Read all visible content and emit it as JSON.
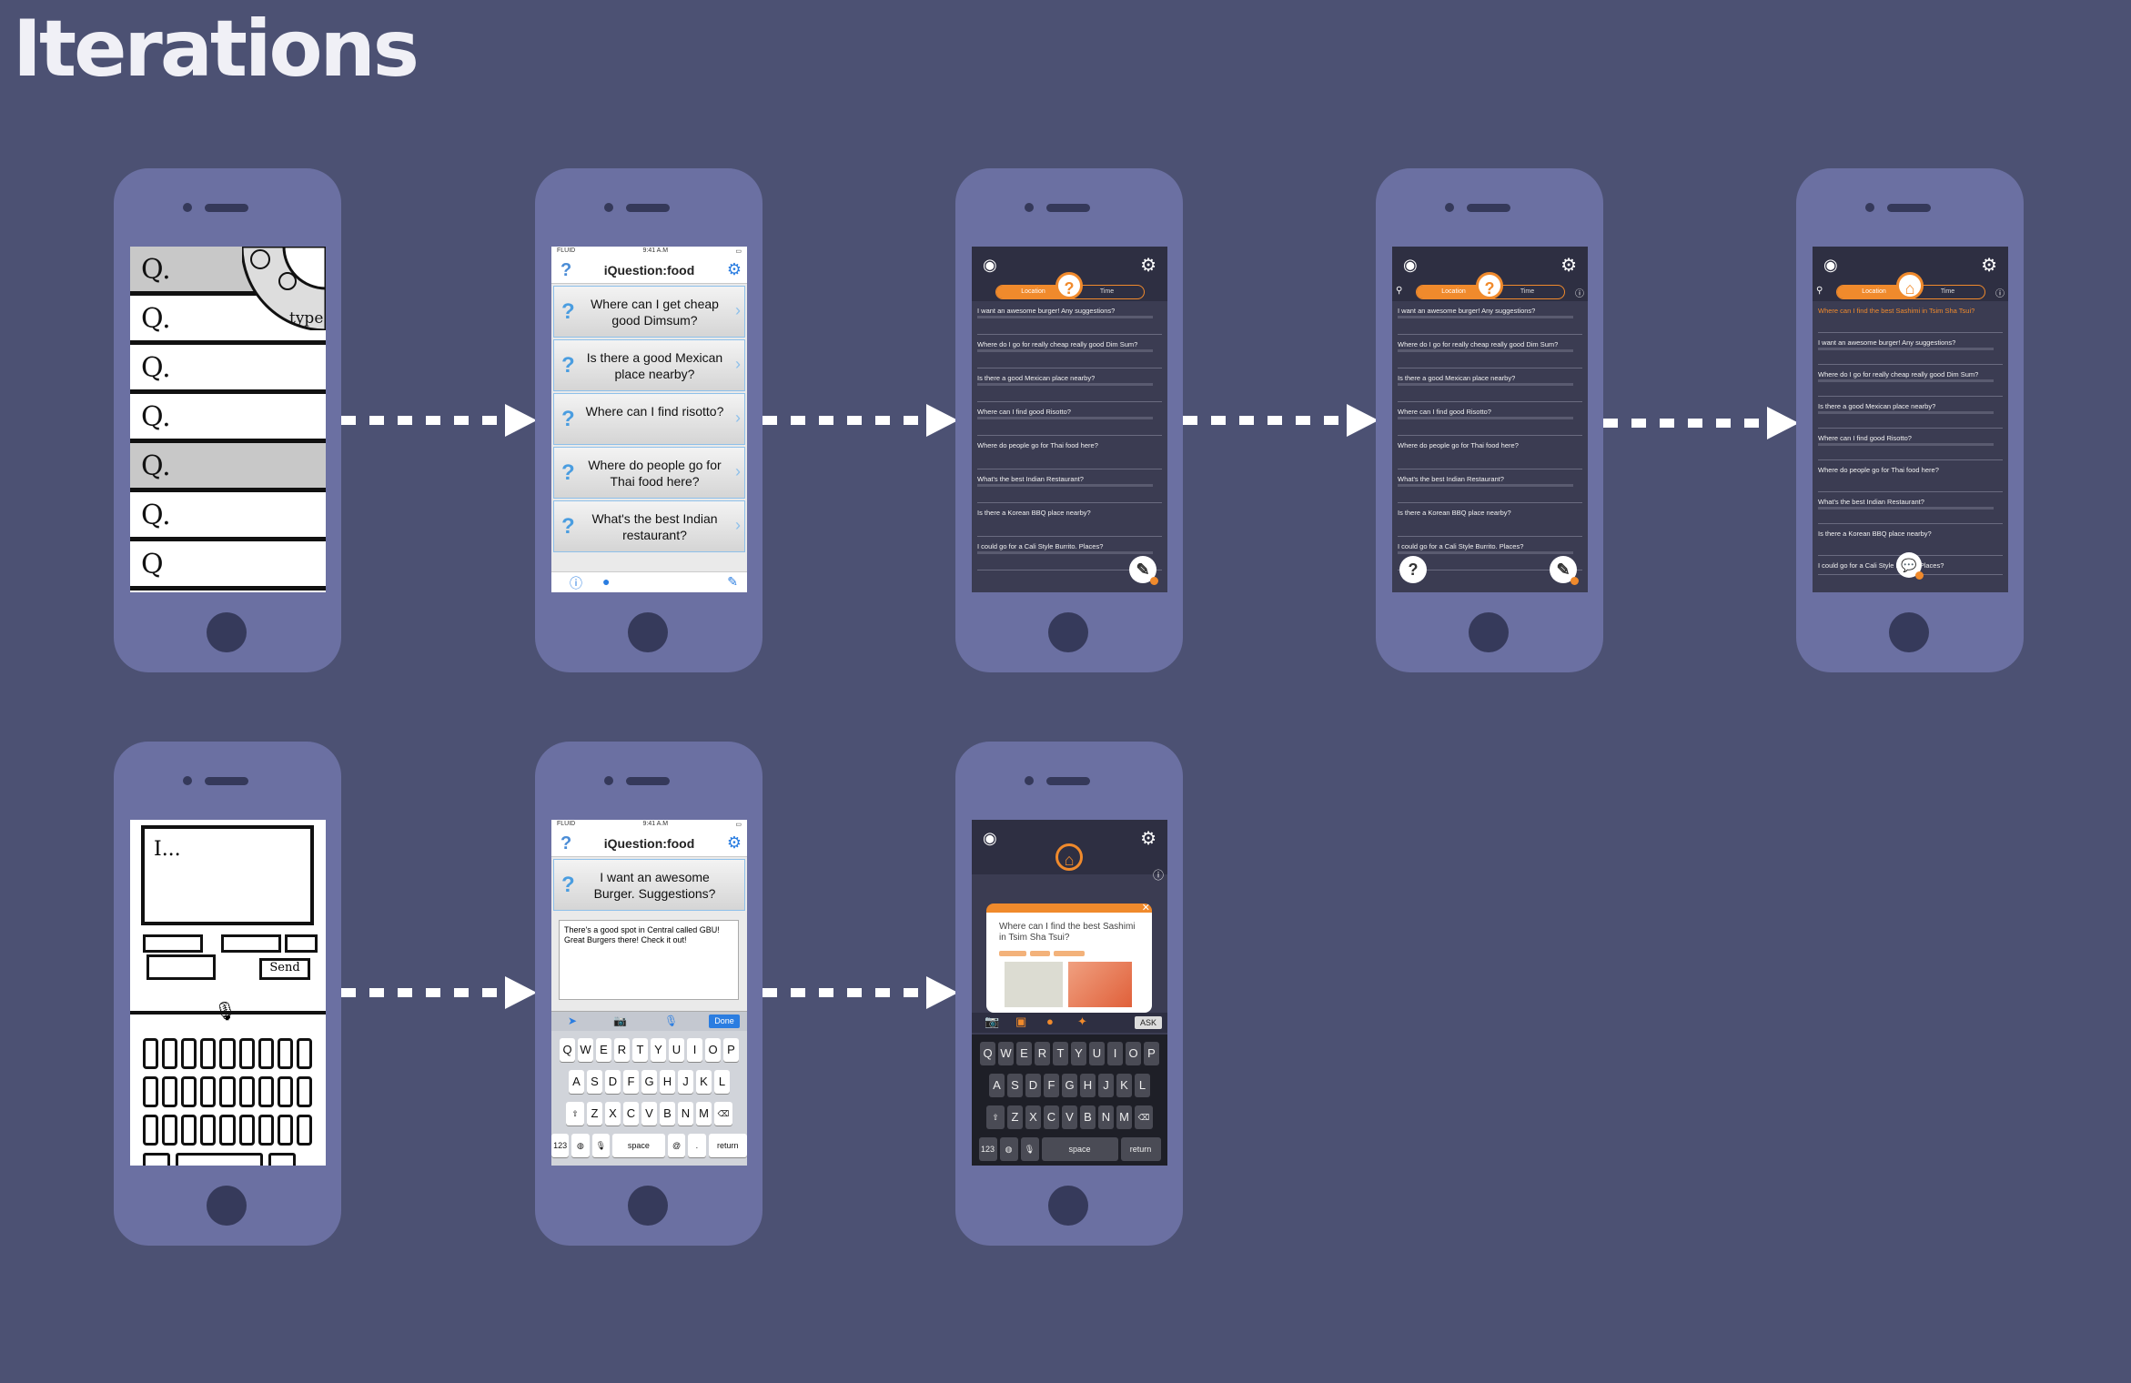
{
  "title": "Iterations",
  "row1": {
    "sketch": {
      "rows": [
        "Q.",
        "Q.",
        "Q.",
        "Q.",
        "Q.",
        "Q.",
        "Q"
      ],
      "dial_label": "type"
    },
    "light": {
      "status_left": "FLUID",
      "status_time": "9:41 A.M",
      "app_title": "iQuestion:food",
      "cards": [
        "Where can I get cheap good Dimsum?",
        "Is there a good Mexican place nearby?",
        "Where can I find risotto?",
        "Where do people go for Thai food here?",
        "What's the best Indian restaurant?"
      ]
    },
    "dark_a": {
      "tabs": [
        "Location",
        "Time"
      ],
      "questions": [
        "I want an awesome burger! Any suggestions?",
        "Where do I go for really cheap really good Dim Sum?",
        "Is there a good Mexican place nearby?",
        "Where can I find good Risotto?",
        "Where do people go for Thai food here?",
        "What's the best Indian Restaurant?",
        "Is there a Korean BBQ place nearby?",
        "I could go for a Cali Style Burrito. Places?"
      ]
    },
    "dark_c": {
      "questions": [
        "Where can I find the best Sashimi in Tsim Sha Tsui?",
        "I want an awesome burger! Any suggestions?",
        "Where do I go for really cheap really good Dim Sum?",
        "Is there a good Mexican place nearby?",
        "Where can I find good Risotto?",
        "Where do people go for Thai food here?",
        "What's the best Indian Restaurant?",
        "Is there a Korean BBQ place nearby?",
        "I could go for a Cali Style Burrito. Places?"
      ]
    }
  },
  "row2": {
    "sketch": {
      "input_text": "I...",
      "send_label": "Send"
    },
    "light": {
      "card": "I want an awesome Burger. Suggestions?",
      "answer": "There's a good spot in Central called GBU! Great Burgers there! Check it out!",
      "done_label": "Done"
    },
    "dark": {
      "question": "Where can I find the best Sashimi in Tsim Sha Tsui?",
      "ask_label": "ASK"
    }
  },
  "keyboard": {
    "row1": [
      "Q",
      "W",
      "E",
      "R",
      "T",
      "Y",
      "U",
      "I",
      "O",
      "P"
    ],
    "row2": [
      "A",
      "S",
      "D",
      "F",
      "G",
      "H",
      "J",
      "K",
      "L"
    ],
    "row3": [
      "Z",
      "X",
      "C",
      "V",
      "B",
      "N",
      "M"
    ],
    "num": "123",
    "space": "space",
    "return": "return"
  }
}
